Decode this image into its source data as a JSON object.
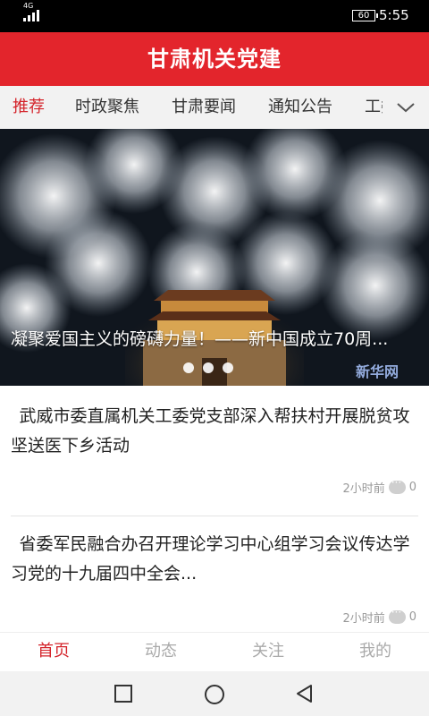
{
  "status": {
    "network": "4G",
    "battery": "60",
    "time": "5:55"
  },
  "app": {
    "title": "甘肃机关党建"
  },
  "tabs": [
    "推荐",
    "时政聚焦",
    "甘肃要闻",
    "通知公告",
    "工委"
  ],
  "banner": {
    "caption": "凝聚爱国主义的磅礴力量！——新中国成立70周...",
    "watermark": "新华网"
  },
  "articles": [
    {
      "title": "武威市委直属机关工委党支部深入帮扶村开展脱贫攻坚送医下乡活动",
      "time": "2小时前",
      "comments": "0"
    },
    {
      "title": "省委军民融合办召开理论学习中心组学习会议传达学习党的十九届四中全会...",
      "time": "2小时前",
      "comments": "0"
    }
  ],
  "bottom_nav": [
    "首页",
    "动态",
    "关注",
    "我的"
  ],
  "colors": {
    "brand": "#e3252c",
    "active": "#d4232a"
  }
}
